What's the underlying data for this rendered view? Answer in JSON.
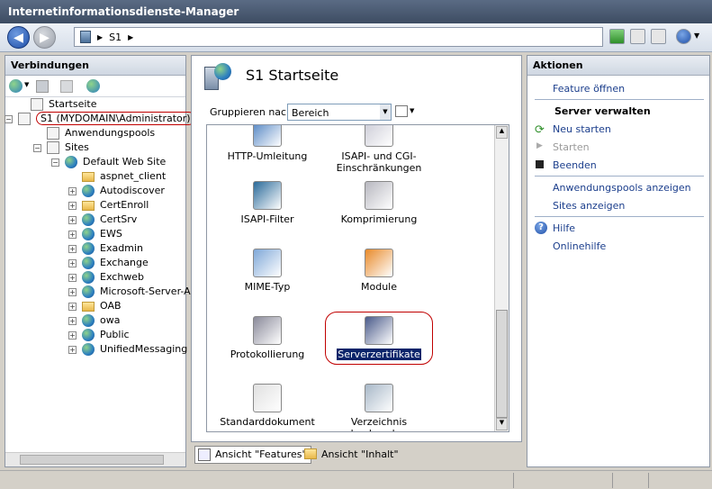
{
  "window": {
    "title": "Internetinformationsdienste-Manager"
  },
  "address": {
    "segments": [
      "S1"
    ]
  },
  "connections": {
    "header": "Verbindungen",
    "tree": [
      {
        "label": "Startseite",
        "depth": 1,
        "icon": "home-icon"
      },
      {
        "label": "S1 (MYDOMAIN\\Administrator)",
        "depth": 0,
        "icon": "server-icon",
        "expanded": true
      },
      {
        "label": "Anwendungspools",
        "depth": 2,
        "icon": "apppool-icon"
      },
      {
        "label": "Sites",
        "depth": 1,
        "icon": "sites-icon",
        "expanded": true
      },
      {
        "label": "Default Web Site",
        "depth": 2,
        "icon": "globe-icon",
        "expanded": true
      },
      {
        "label": "aspnet_client",
        "depth": 3,
        "icon": "folder-icon"
      },
      {
        "label": "Autodiscover",
        "depth": 3,
        "icon": "globe-icon"
      },
      {
        "label": "CertEnroll",
        "depth": 3,
        "icon": "folder-icon"
      },
      {
        "label": "CertSrv",
        "depth": 3,
        "icon": "globe-icon"
      },
      {
        "label": "EWS",
        "depth": 3,
        "icon": "globe-icon"
      },
      {
        "label": "Exadmin",
        "depth": 3,
        "icon": "globe-icon"
      },
      {
        "label": "Exchange",
        "depth": 3,
        "icon": "globe-icon"
      },
      {
        "label": "Exchweb",
        "depth": 3,
        "icon": "globe-icon"
      },
      {
        "label": "Microsoft-Server-Ac",
        "depth": 3,
        "icon": "globe-icon"
      },
      {
        "label": "OAB",
        "depth": 3,
        "icon": "folder-icon"
      },
      {
        "label": "owa",
        "depth": 3,
        "icon": "globe-icon"
      },
      {
        "label": "Public",
        "depth": 3,
        "icon": "globe-icon"
      },
      {
        "label": "UnifiedMessaging",
        "depth": 3,
        "icon": "globe-icon"
      }
    ]
  },
  "center": {
    "title": "S1 Startseite",
    "group_label": "Gruppieren nach:",
    "group_value": "Bereich",
    "features": [
      {
        "label": "HTTP-Umleitung",
        "icon": "redirect-icon"
      },
      {
        "label": "ISAPI- und CGI-Einschränkungen",
        "icon": "isapi-cgi-icon"
      },
      {
        "label": "ISAPI-Filter",
        "icon": "isapi-filter-icon"
      },
      {
        "label": "Komprimierung",
        "icon": "compression-icon"
      },
      {
        "label": "MIME-Typ",
        "icon": "mime-icon"
      },
      {
        "label": "Module",
        "icon": "modules-icon"
      },
      {
        "label": "Protokollierung",
        "icon": "logging-icon"
      },
      {
        "label": "Serverzertifikate",
        "icon": "certificates-icon",
        "selected": true
      },
      {
        "label": "Standarddokument",
        "icon": "default-doc-icon"
      },
      {
        "label": "Verzeichnis durchsuchen",
        "icon": "dir-browse-icon"
      }
    ],
    "view_features": "Ansicht \"Features\"",
    "view_content": "Ansicht \"Inhalt\""
  },
  "actions": {
    "header": "Aktionen",
    "feature_open": "Feature öffnen",
    "server_section": "Server verwalten",
    "restart": "Neu starten",
    "start": "Starten",
    "stop": "Beenden",
    "app_pools": "Anwendungspools anzeigen",
    "sites": "Sites anzeigen",
    "help": "Hilfe",
    "online_help": "Onlinehilfe"
  },
  "colors": {
    "link": "#1b3e8c",
    "highlight": "#c00000",
    "selection": "#0a246a"
  }
}
